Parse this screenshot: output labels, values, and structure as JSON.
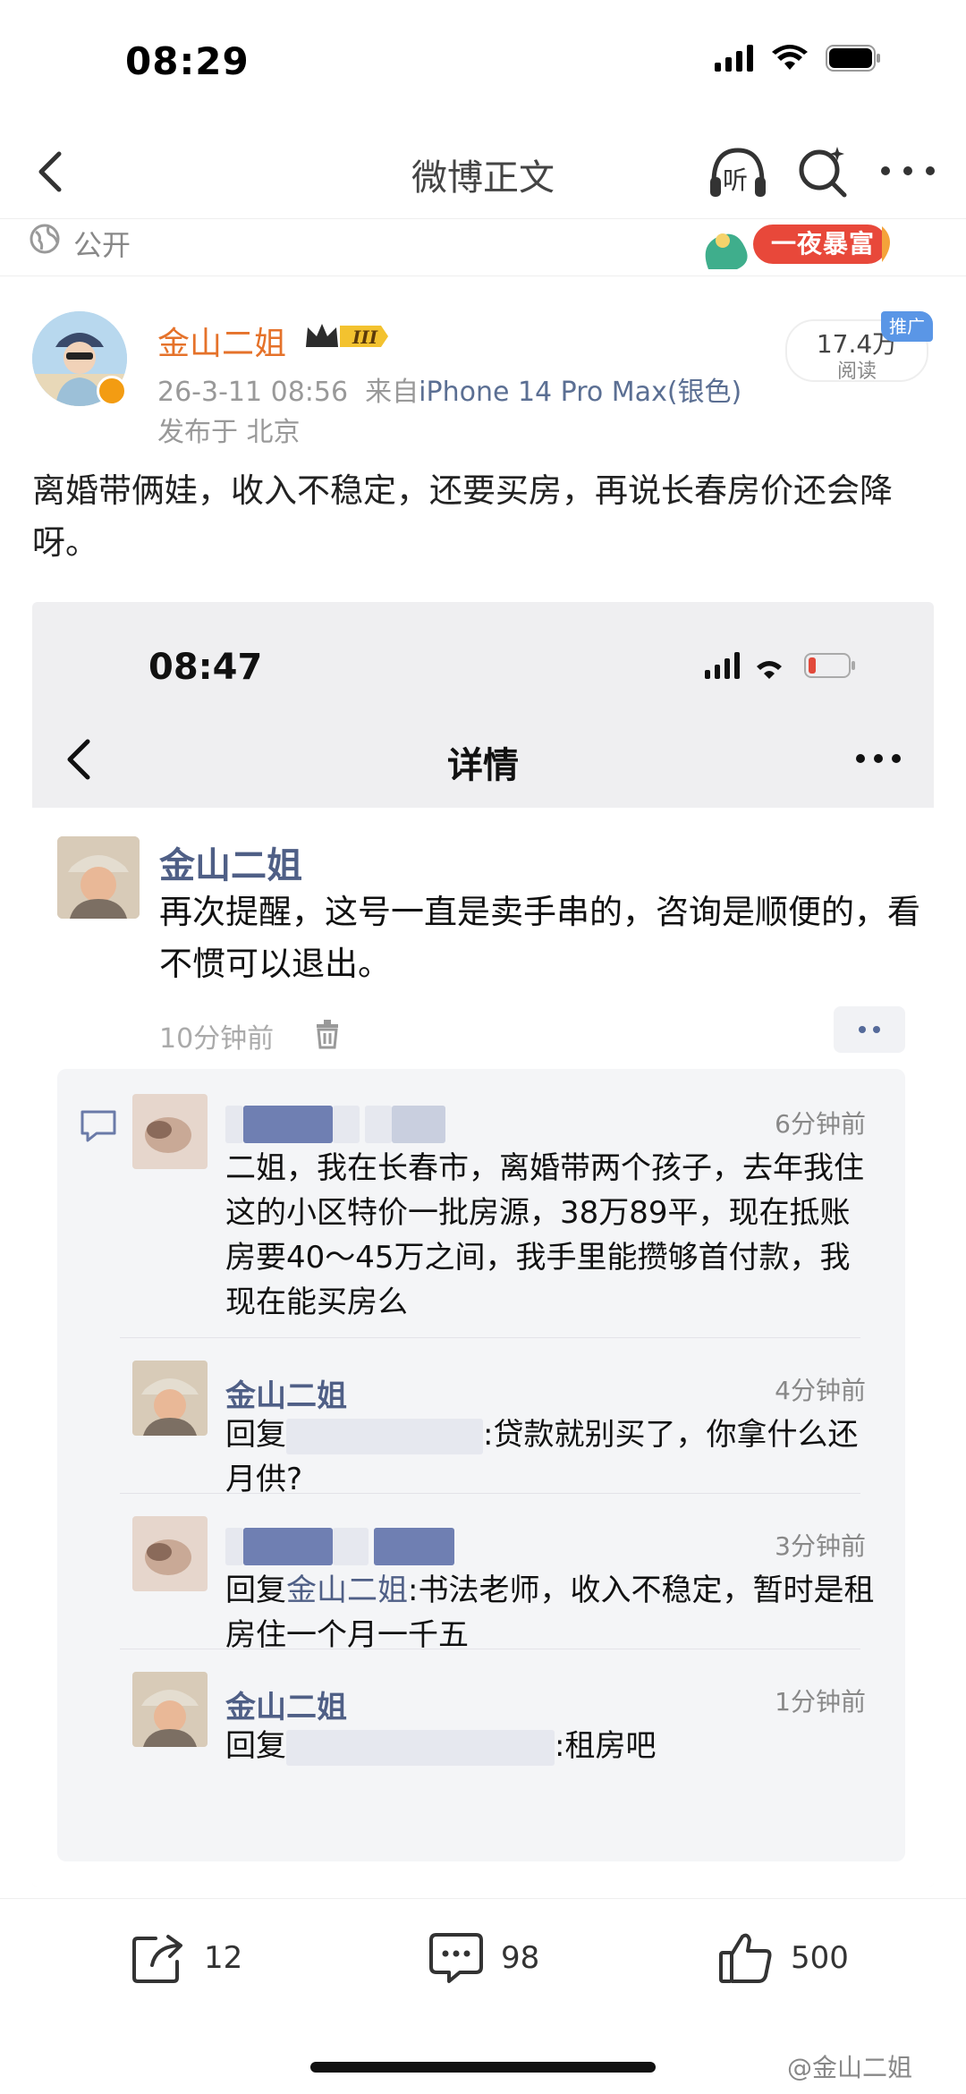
{
  "status_bar": {
    "time": "08:29"
  },
  "nav": {
    "title": "微博正文",
    "listen_label": "听"
  },
  "visibility": {
    "label": "公开"
  },
  "banner": {
    "text": "一夜暴富"
  },
  "post": {
    "author": "金山二姐",
    "level_badge": "III",
    "datetime": "26-3-11 08:56",
    "source_prefix": "来自",
    "device": "iPhone 14 Pro Max(银色)",
    "location": "发布于 北京",
    "reads_value": "17.4万",
    "reads_label": "阅读",
    "ad_label": "推广",
    "text": "离婚带俩娃，收入不稳定，还要买房，再说长春房价还会降呀。"
  },
  "embed": {
    "status_time": "08:47",
    "title": "详情",
    "comment": {
      "author": "金山二姐",
      "text": "再次提醒，这号一直是卖手串的，咨询是顺便的，看不惯可以退出。",
      "time": "10分钟前"
    },
    "replies": [
      {
        "name": "",
        "time": "6分钟前",
        "text": "二姐，我在长春市，离婚带两个孩子，去年我住这的小区特价一批房源，38万89平，现在抵账房要40～45万之间，我手里能攒够首付款，我现在能买房么"
      },
      {
        "name": "金山二姐",
        "time": "4分钟前",
        "prefix": "回复",
        "text": ":贷款就别买了，你拿什么还月供?"
      },
      {
        "name": "",
        "time": "3分钟前",
        "prefix": "回复",
        "mention": "金山二姐",
        "text": ":书法老师，收入不稳定，暂时是租房住一个月一千五"
      },
      {
        "name": "金山二姐",
        "time": "1分钟前",
        "prefix": "回复",
        "text": ":租房吧"
      }
    ]
  },
  "actions": {
    "repost_count": "12",
    "comment_count": "98",
    "like_count": "500"
  },
  "watermark": "@金山二姐",
  "colors": {
    "author_orange": "#e5722a",
    "link_blue": "#4f5f86",
    "meta_gray": "#999999",
    "ad_blue": "#5a96e6"
  }
}
